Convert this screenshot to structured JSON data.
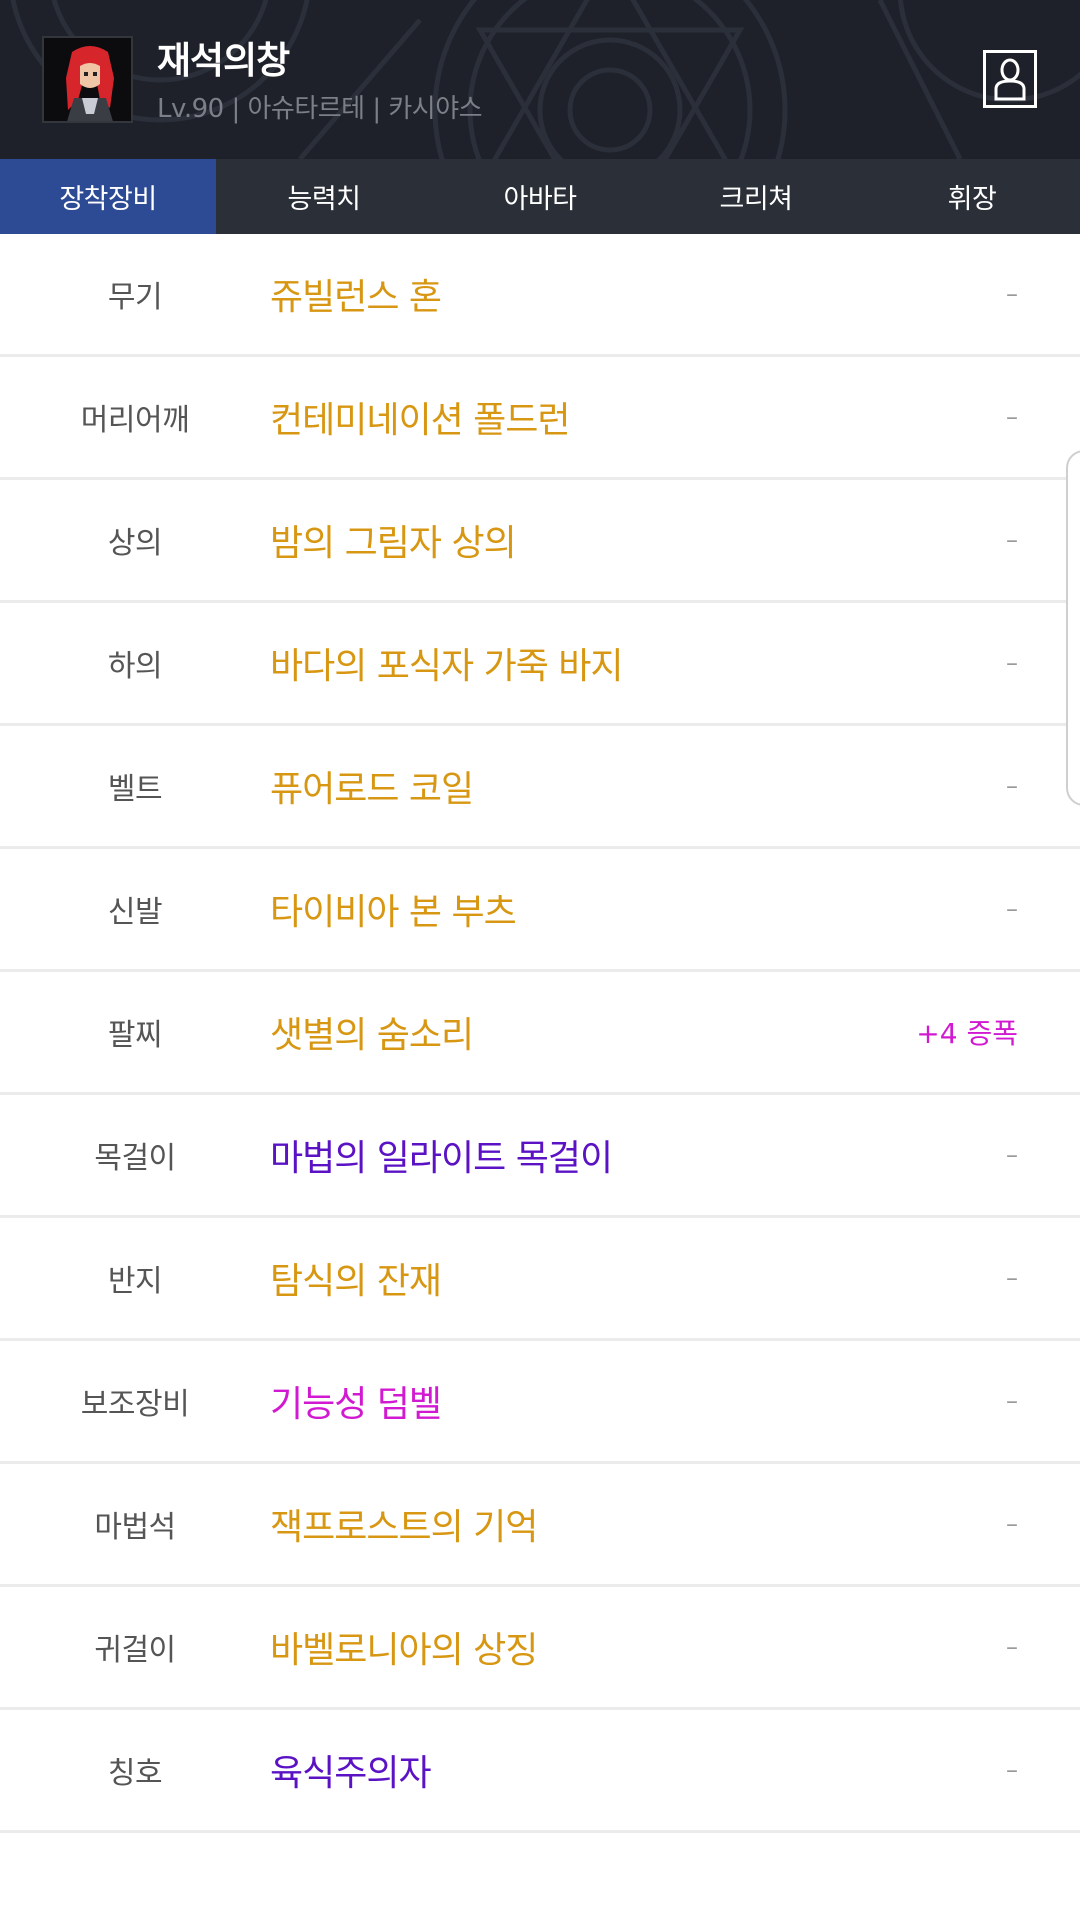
{
  "header": {
    "character_name": "재석의창",
    "info_line": "Lv.90 | 아슈타르테 | 카시야스",
    "avatar_icon": "character-portrait-icon",
    "profile_icon": "person-icon"
  },
  "tabs": [
    {
      "label": "장착장비",
      "active": true
    },
    {
      "label": "능력치",
      "active": false
    },
    {
      "label": "아바타",
      "active": false
    },
    {
      "label": "크리쳐",
      "active": false
    },
    {
      "label": "휘장",
      "active": false
    }
  ],
  "colors": {
    "unique": "#d89712",
    "rare": "#5a12c4",
    "epic_magenta": "#d219d2",
    "tab_active": "#2d4a94",
    "header_bg": "#1e2129"
  },
  "equipment": [
    {
      "slot": "무기",
      "item": "쥬빌런스 혼",
      "item_color": "#d89712",
      "extra": "–",
      "extra_color": "#9a9a9a"
    },
    {
      "slot": "머리어깨",
      "item": "컨테미네이션 폴드런",
      "item_color": "#d89712",
      "extra": "–",
      "extra_color": "#9a9a9a"
    },
    {
      "slot": "상의",
      "item": "밤의 그림자 상의",
      "item_color": "#d89712",
      "extra": "–",
      "extra_color": "#9a9a9a"
    },
    {
      "slot": "하의",
      "item": "바다의 포식자 가죽 바지",
      "item_color": "#d89712",
      "extra": "–",
      "extra_color": "#9a9a9a"
    },
    {
      "slot": "벨트",
      "item": "퓨어로드 코일",
      "item_color": "#d89712",
      "extra": "–",
      "extra_color": "#9a9a9a"
    },
    {
      "slot": "신발",
      "item": "타이비아 본 부츠",
      "item_color": "#d89712",
      "extra": "–",
      "extra_color": "#9a9a9a"
    },
    {
      "slot": "팔찌",
      "item": "샛별의 숨소리",
      "item_color": "#d89712",
      "extra": "+4 증폭",
      "extra_color": "#d219d2"
    },
    {
      "slot": "목걸이",
      "item": "마법의 일라이트 목걸이",
      "item_color": "#5a12c4",
      "extra": "–",
      "extra_color": "#9a9a9a"
    },
    {
      "slot": "반지",
      "item": "탐식의 잔재",
      "item_color": "#d89712",
      "extra": "–",
      "extra_color": "#9a9a9a"
    },
    {
      "slot": "보조장비",
      "item": "기능성 덤벨",
      "item_color": "#d219d2",
      "extra": "–",
      "extra_color": "#9a9a9a"
    },
    {
      "slot": "마법석",
      "item": "잭프로스트의 기억",
      "item_color": "#d89712",
      "extra": "–",
      "extra_color": "#9a9a9a"
    },
    {
      "slot": "귀걸이",
      "item": "바벨로니아의 상징",
      "item_color": "#d89712",
      "extra": "–",
      "extra_color": "#9a9a9a"
    },
    {
      "slot": "칭호",
      "item": "육식주의자",
      "item_color": "#5a12c4",
      "extra": "–",
      "extra_color": "#9a9a9a"
    }
  ]
}
